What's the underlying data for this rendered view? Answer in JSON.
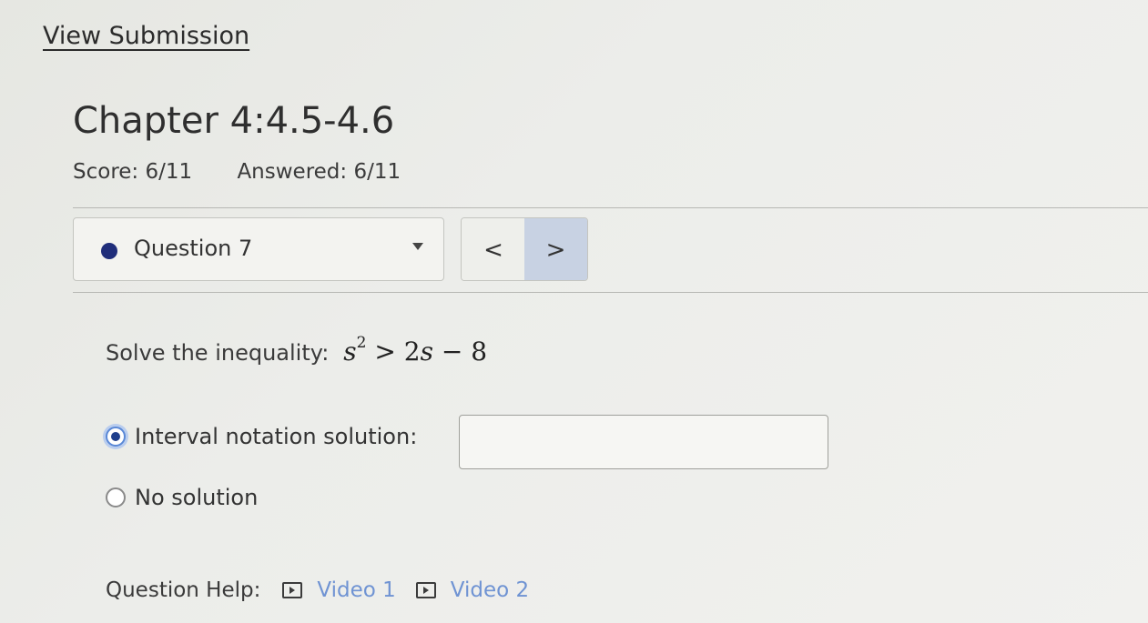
{
  "header": {
    "view_submission": "View Submission",
    "title": "Chapter 4:4.5-4.6",
    "score": "Score: 6/11",
    "answered": "Answered: 6/11"
  },
  "question_nav": {
    "selected": "Question 7",
    "prev": "<",
    "next": ">"
  },
  "problem": {
    "prompt": "Solve the inequality:",
    "lhs_var": "s",
    "lhs_exp": "2",
    "rhs": "> 2",
    "rhs_var": "s",
    "rhs_tail": " − 8"
  },
  "options": [
    {
      "label": "Interval notation solution:",
      "checked": true
    },
    {
      "label": "No solution",
      "checked": false
    }
  ],
  "answer": {
    "value": ""
  },
  "help": {
    "label": "Question Help:",
    "videos": [
      "Video 1",
      "Video 2"
    ]
  },
  "icons": {
    "status": "filled-circle-icon",
    "dropdown": "caret-down-icon",
    "video": "play-box-icon"
  },
  "colors": {
    "status_dot": "#1f2d7a",
    "link": "#6f93d3",
    "next_button": "#c8d2e3"
  }
}
